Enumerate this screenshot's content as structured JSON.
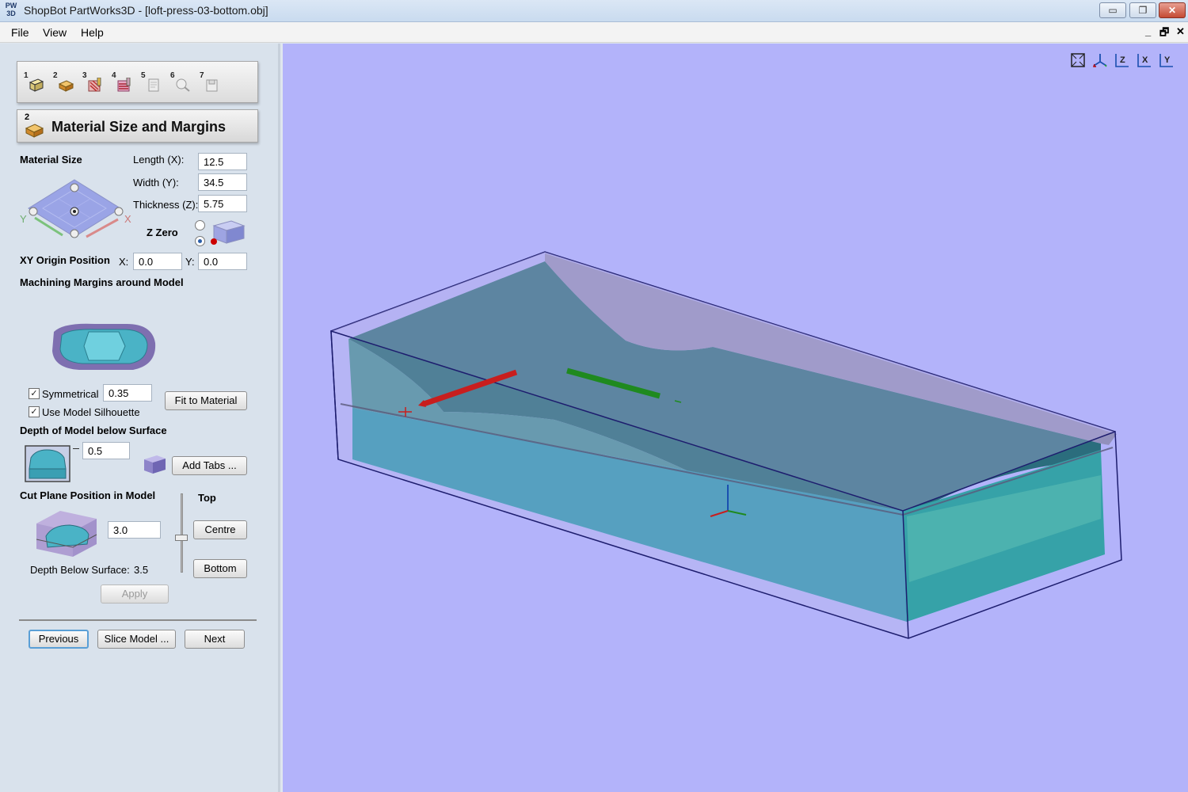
{
  "window": {
    "app_icon": "PW 3D",
    "title": "ShopBot PartWorks3D - [loft-press-03-bottom.obj]",
    "controls": {
      "minimize": "▭",
      "restore": "❐",
      "close": "✕"
    }
  },
  "menu": {
    "items": [
      "File",
      "View",
      "Help"
    ],
    "mdi_controls": {
      "minimize": "_",
      "restore": "🗗",
      "close": "✕"
    }
  },
  "toolbar": {
    "steps": [
      {
        "num": "1",
        "icon": "material-block-icon"
      },
      {
        "num": "2",
        "icon": "material-size-icon"
      },
      {
        "num": "3",
        "icon": "toolpath-roughing-icon"
      },
      {
        "num": "4",
        "icon": "toolpath-finishing-icon"
      },
      {
        "num": "5",
        "icon": "preview-icon"
      },
      {
        "num": "6",
        "icon": "simulate-icon"
      },
      {
        "num": "7",
        "icon": "save-toolpath-icon"
      }
    ]
  },
  "section": {
    "number": "2",
    "title": "Material Size and Margins"
  },
  "material_size": {
    "heading": "Material Size",
    "length_label": "Length (X):",
    "length_value": "12.5",
    "width_label": "Width (Y):",
    "width_value": "34.5",
    "thickness_label": "Thickness (Z):",
    "thickness_value": "5.75",
    "z_zero_label": "Z Zero",
    "z_zero_selected": "bottom",
    "axis_x": "X",
    "axis_y": "Y"
  },
  "xy_origin": {
    "heading": "XY Origin Position",
    "x_label": "X:",
    "x_value": "0.0",
    "y_label": "Y:",
    "y_value": "0.0"
  },
  "margins": {
    "heading": "Machining Margins around Model",
    "symmetrical_label": "Symmetrical",
    "symmetrical_checked": true,
    "symmetrical_value": "0.35",
    "silhouette_label": "Use Model Silhouette",
    "silhouette_checked": true,
    "fit_button": "Fit to Material"
  },
  "depth": {
    "heading": "Depth of Model below Surface",
    "value": "0.5",
    "add_tabs_button": "Add Tabs ..."
  },
  "cut_plane": {
    "heading": "Cut Plane Position in Model",
    "value": "3.0",
    "top_label": "Top",
    "centre_button": "Centre",
    "bottom_button": "Bottom",
    "depth_below_label": "Depth Below Surface:",
    "depth_below_value": "3.5",
    "apply_button": "Apply"
  },
  "nav": {
    "previous": "Previous",
    "slice": "Slice Model ...",
    "next": "Next"
  },
  "viewport": {
    "background": "#b3b3fa",
    "view_tools": [
      {
        "icon": "zoom-extents-icon",
        "text": "⛶"
      },
      {
        "icon": "iso-view-icon",
        "text": "⊥"
      },
      {
        "icon": "view-z-icon",
        "text": "Z"
      },
      {
        "icon": "view-x-icon",
        "text": "X"
      },
      {
        "icon": "view-y-icon",
        "text": "Y"
      }
    ]
  }
}
